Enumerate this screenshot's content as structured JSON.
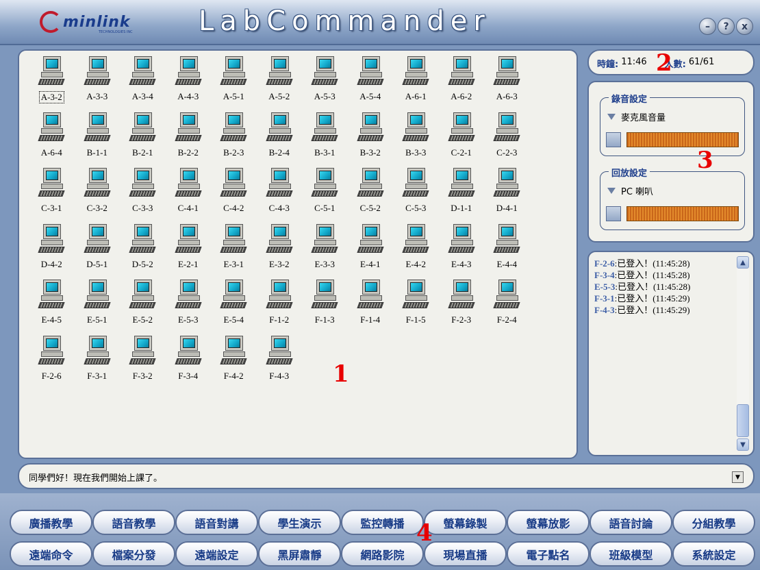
{
  "app": {
    "logo_text": "minlink",
    "logo_tagline": "TECHNOLOGIES INC",
    "title": "LabCommander",
    "window_buttons": [
      "–",
      "?",
      "x"
    ]
  },
  "desks": [
    "A-3-2",
    "A-3-3",
    "A-3-4",
    "A-4-3",
    "A-5-1",
    "A-5-2",
    "A-5-3",
    "A-5-4",
    "A-6-1",
    "A-6-2",
    "A-6-3",
    "A-6-4",
    "B-1-1",
    "B-2-1",
    "B-2-2",
    "B-2-3",
    "B-2-4",
    "B-3-1",
    "B-3-2",
    "B-3-3",
    "C-2-1",
    "C-2-3",
    "C-3-1",
    "C-3-2",
    "C-3-3",
    "C-4-1",
    "C-4-2",
    "C-4-3",
    "C-5-1",
    "C-5-2",
    "C-5-3",
    "D-1-1",
    "D-4-1",
    "D-4-2",
    "D-5-1",
    "D-5-2",
    "E-2-1",
    "E-3-1",
    "E-3-2",
    "E-3-3",
    "E-4-1",
    "E-4-2",
    "E-4-3",
    "E-4-4",
    "E-4-5",
    "E-5-1",
    "E-5-2",
    "E-5-3",
    "E-5-4",
    "F-1-2",
    "F-1-3",
    "F-1-4",
    "F-1-5",
    "F-2-3",
    "F-2-4",
    "F-2-6",
    "F-3-1",
    "F-3-2",
    "F-3-4",
    "F-4-2",
    "F-4-3"
  ],
  "annotations": [
    "1",
    "2",
    "3",
    "4"
  ],
  "info": {
    "clock_label": "時鐘:",
    "clock_value": "11:46",
    "count_label": "人數:",
    "count_value": "61/61"
  },
  "recording": {
    "title": "錄音設定",
    "source": "麥克風音量"
  },
  "playback": {
    "title": "回放設定",
    "source": "PC 喇叭"
  },
  "log": [
    {
      "id": "F-2-6",
      "text": ":已登入！(11:45:28)"
    },
    {
      "id": "F-3-4",
      "text": ":已登入！(11:45:28)"
    },
    {
      "id": "E-5-3",
      "text": ":已登入！(11:45:28)"
    },
    {
      "id": "F-3-1",
      "text": ":已登入！(11:45:29)"
    },
    {
      "id": "F-4-3",
      "text": ":已登入！(11:45:29)"
    }
  ],
  "message": {
    "text": "同學們好！現在我們開始上課了。"
  },
  "toolbar_row1": [
    "廣播教學",
    "語音教學",
    "語音對講",
    "學生演示",
    "監控轉播",
    "螢幕錄製",
    "螢幕放影",
    "語音討論",
    "分組教學"
  ],
  "toolbar_row2": [
    "遠端命令",
    "檔案分發",
    "遠端設定",
    "黑屏肅靜",
    "網路影院",
    "現場直播",
    "電子點名",
    "班級模型",
    "系統設定"
  ],
  "colors": {
    "accent": "#1f3f8c",
    "annotation": "#e80000",
    "meter": "#e38a2c"
  }
}
